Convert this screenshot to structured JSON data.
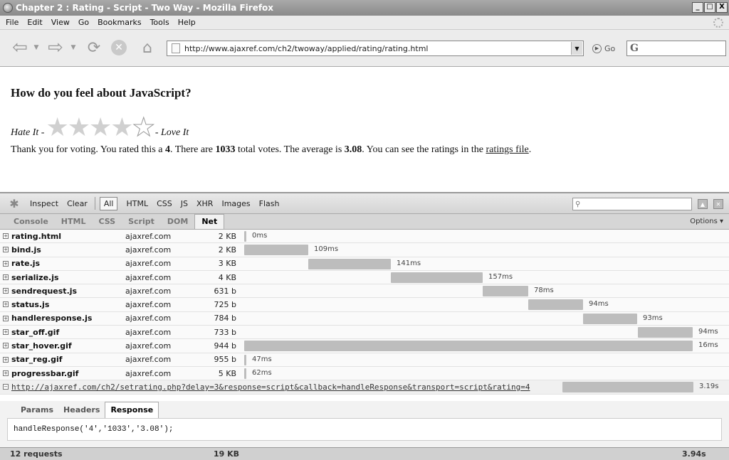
{
  "window": {
    "title": "Chapter 2 : Rating - Script - Two Way - Mozilla Firefox",
    "buttons": [
      "_",
      "□",
      "X"
    ]
  },
  "menu": [
    "File",
    "Edit",
    "View",
    "Go",
    "Bookmarks",
    "Tools",
    "Help"
  ],
  "nav": {
    "url": "http://www.ajaxref.com/ch2/twoway/applied/rating/rating.html",
    "go_label": "Go",
    "search_engine": "G"
  },
  "content": {
    "heading": "How do you feel about JavaScript?",
    "hate_label": "Hate It -",
    "love_label": "- Love It",
    "rating": 4,
    "max_rating": 5,
    "msg_1": "Thank you for voting. You rated this a ",
    "rated": "4",
    "msg_2": ". There are ",
    "votes": "1033",
    "msg_3": " total votes. The average is ",
    "average": "3.08",
    "msg_4": ". You can see the ratings in the ",
    "link": "ratings file",
    "msg_5": "."
  },
  "firebug": {
    "toolbar": [
      "Inspect",
      "Clear",
      "All",
      "HTML",
      "CSS",
      "JS",
      "XHR",
      "Images",
      "Flash"
    ],
    "selected_filter": "All",
    "panels": [
      "Console",
      "HTML",
      "CSS",
      "Script",
      "DOM",
      "Net"
    ],
    "active_panel": "Net",
    "options_label": "Options ▾",
    "total_ms": 3940,
    "requests": [
      {
        "file": "rating.html",
        "domain": "ajaxref.com",
        "size": "2 KB",
        "start": 0,
        "duration": 0,
        "label": "0ms"
      },
      {
        "file": "bind.js",
        "domain": "ajaxref.com",
        "size": "2 KB",
        "start": 0,
        "duration": 109,
        "label": "109ms"
      },
      {
        "file": "rate.js",
        "domain": "ajaxref.com",
        "size": "3 KB",
        "start": 109,
        "duration": 141,
        "label": "141ms"
      },
      {
        "file": "serialize.js",
        "domain": "ajaxref.com",
        "size": "4 KB",
        "start": 250,
        "duration": 157,
        "label": "157ms"
      },
      {
        "file": "sendrequest.js",
        "domain": "ajaxref.com",
        "size": "631 b",
        "start": 407,
        "duration": 78,
        "label": "78ms"
      },
      {
        "file": "status.js",
        "domain": "ajaxref.com",
        "size": "725 b",
        "start": 485,
        "duration": 94,
        "label": "94ms"
      },
      {
        "file": "handleresponse.js",
        "domain": "ajaxref.com",
        "size": "784 b",
        "start": 579,
        "duration": 93,
        "label": "93ms"
      },
      {
        "file": "star_off.gif",
        "domain": "ajaxref.com",
        "size": "733 b",
        "start": 672,
        "duration": 94,
        "label": "94ms"
      },
      {
        "file": "star_hover.gif",
        "domain": "ajaxref.com",
        "size": "944 b",
        "start": 0,
        "duration": 766,
        "label": "16ms"
      },
      {
        "file": "star_reg.gif",
        "domain": "ajaxref.com",
        "size": "955 b",
        "start": 0,
        "duration": 0,
        "label": "47ms"
      },
      {
        "file": "progressbar.gif",
        "domain": "ajaxref.com",
        "size": "5 KB",
        "start": 0,
        "duration": 0,
        "label": "62ms"
      }
    ],
    "script_request": {
      "url": "http://ajaxref.com/ch2/setrating.php?delay=3&response=script&callback=handleResponse&transport=script&rating=4",
      "start": 550,
      "duration": 220,
      "label": "3.19s"
    },
    "response_tabs": [
      "Params",
      "Headers",
      "Response"
    ],
    "active_response_tab": "Response",
    "response_body": "handleResponse('4','1033','3.08');",
    "status": {
      "requests": "12 requests",
      "size": "19 KB",
      "time": "3.94s"
    }
  }
}
